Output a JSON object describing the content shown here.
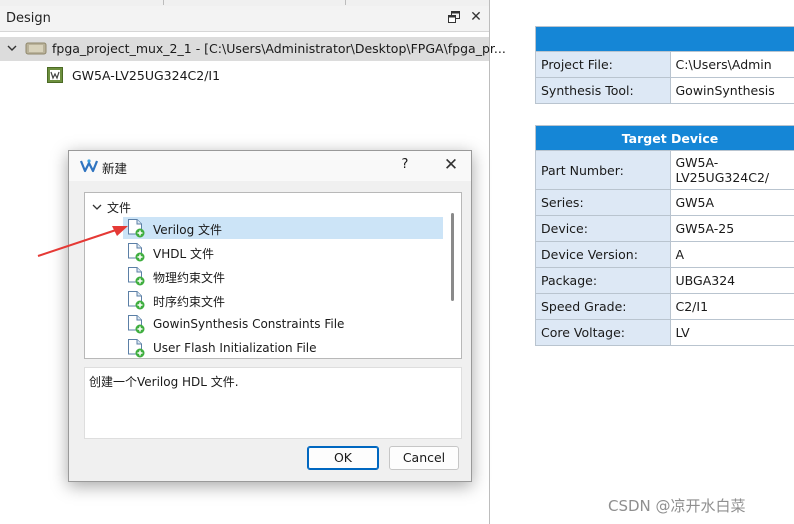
{
  "design_panel": {
    "title": "Design",
    "float_icon": "float-window-icon",
    "close_icon": "close-icon",
    "project": {
      "label": "fpga_project_mux_2_1 - [C:\\Users\\Administrator\\Desktop\\FPGA\\fpga_pr...",
      "icon": "project-chip-icon",
      "chevron": "chevron-down-icon"
    },
    "device": {
      "label": "GW5A-LV25UG324C2/I1",
      "icon": "device-chip-icon"
    }
  },
  "report": {
    "general_rows": [
      {
        "key": "Project File:",
        "value": "C:\\Users\\Admin"
      },
      {
        "key": "Synthesis Tool:",
        "value": "GowinSynthesis"
      }
    ],
    "target_device": {
      "title": "Target Device",
      "rows": [
        {
          "key": "Part Number:",
          "value": "GW5A-"
        },
        {
          "key": "Series:",
          "value": "GW5A"
        },
        {
          "key": "Device:",
          "value": "GW5A-25"
        },
        {
          "key": "Device Version:",
          "value": "A"
        },
        {
          "key": "Package:",
          "value": "UBGA324"
        },
        {
          "key": "Speed Grade:",
          "value": "C2/I1"
        },
        {
          "key": "Core Voltage:",
          "value": "LV"
        }
      ],
      "part_number_line2": "LV25UG324C2/"
    },
    "header_color": "#1586d6",
    "key_cell_color": "#dde8f5"
  },
  "dialog": {
    "title": "新建",
    "help_label": "?",
    "close_label": "✕",
    "logo_icon": "gowin-logo-icon",
    "group_label": "文件",
    "items": [
      {
        "label": "Verilog 文件",
        "icon": "file-add-icon",
        "selected": true
      },
      {
        "label": "VHDL 文件",
        "icon": "file-add-icon",
        "selected": false
      },
      {
        "label": "物理约束文件",
        "icon": "file-add-icon",
        "selected": false
      },
      {
        "label": "时序约束文件",
        "icon": "file-add-icon",
        "selected": false
      },
      {
        "label": "GowinSynthesis Constraints File",
        "icon": "file-add-icon",
        "selected": false
      },
      {
        "label": "User Flash Initialization File",
        "icon": "file-add-icon",
        "selected": false
      }
    ],
    "description": "创建一个Verilog HDL 文件.",
    "ok_label": "OK",
    "cancel_label": "Cancel",
    "accent": "#0067c0"
  },
  "annotation": {
    "arrow_icon": "red-arrow-icon",
    "color": "#e53935"
  },
  "watermark": "CSDN @凉开水白菜"
}
